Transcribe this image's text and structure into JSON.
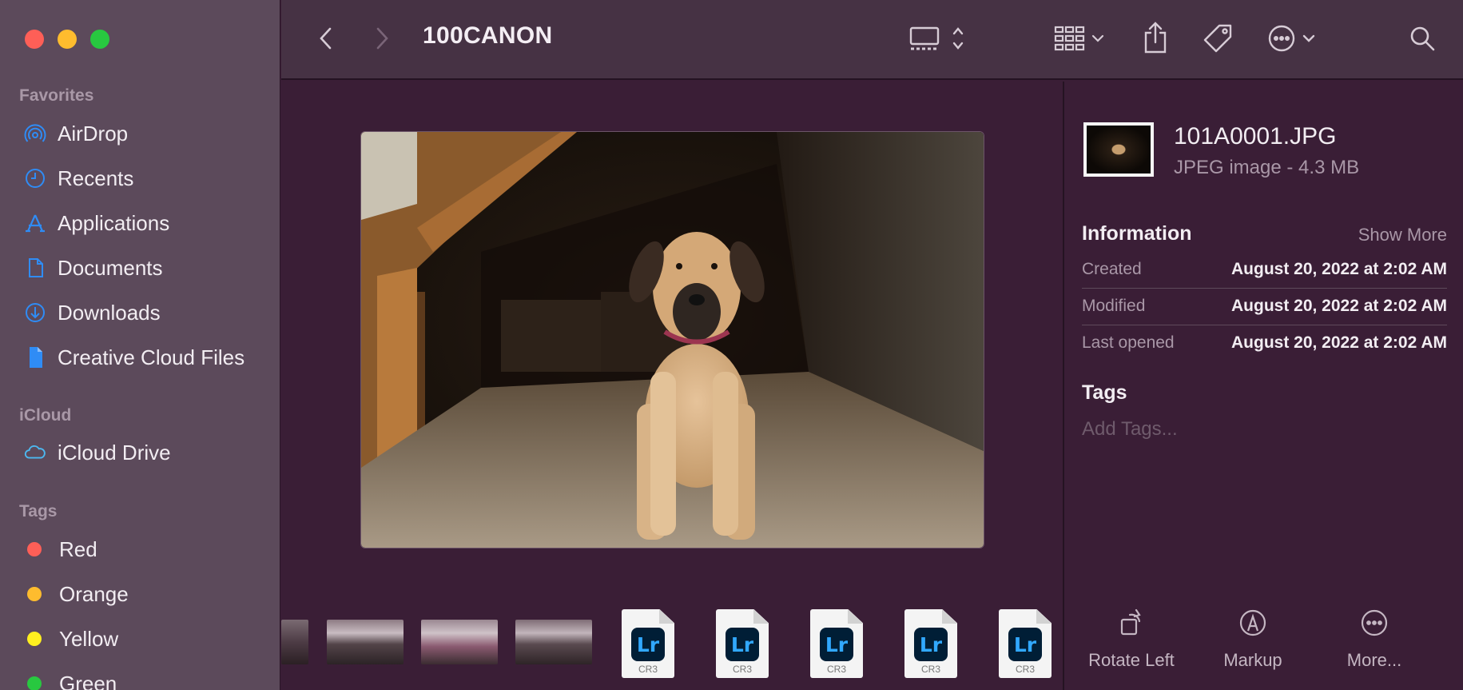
{
  "window": {
    "title": "100CANON"
  },
  "sidebar": {
    "favorites_title": "Favorites",
    "favorites": [
      {
        "label": "AirDrop",
        "icon": "airdrop-icon"
      },
      {
        "label": "Recents",
        "icon": "clock-icon"
      },
      {
        "label": "Applications",
        "icon": "applications-icon"
      },
      {
        "label": "Documents",
        "icon": "document-icon"
      },
      {
        "label": "Downloads",
        "icon": "download-icon"
      },
      {
        "label": "Creative Cloud Files",
        "icon": "file-icon"
      }
    ],
    "icloud_title": "iCloud",
    "icloud": [
      {
        "label": "iCloud Drive",
        "icon": "cloud-icon"
      }
    ],
    "tags_title": "Tags",
    "tags": [
      {
        "label": "Red",
        "color": "#fe5f57"
      },
      {
        "label": "Orange",
        "color": "#febc2e"
      },
      {
        "label": "Yellow",
        "color": "#fff01f"
      },
      {
        "label": "Green",
        "color": "#28c840"
      }
    ]
  },
  "toolbar": {
    "icons": [
      "back-icon",
      "forward-icon",
      "view-gallery-icon",
      "group-icon",
      "share-icon",
      "tag-icon",
      "more-icon",
      "search-icon"
    ]
  },
  "filmstrip": {
    "cr3_label": "Lr",
    "cr3_ext": "CR3"
  },
  "inspector": {
    "file_name": "101A0001.JPG",
    "file_kind": "JPEG image - 4.3 MB",
    "information_title": "Information",
    "show_more": "Show More",
    "rows": [
      {
        "key": "Created",
        "value": "August 20, 2022 at 2:02 AM"
      },
      {
        "key": "Modified",
        "value": "August 20, 2022 at 2:02 AM"
      },
      {
        "key": "Last opened",
        "value": "August 20, 2022 at 2:02 AM"
      }
    ],
    "tags_title": "Tags",
    "add_tags_placeholder": "Add Tags...",
    "actions": [
      {
        "label": "Rotate Left",
        "icon": "rotate-left-icon"
      },
      {
        "label": "Markup",
        "icon": "markup-icon"
      },
      {
        "label": "More...",
        "icon": "more-circle-icon"
      }
    ]
  },
  "colors": {
    "accent": "#2f8cf5",
    "background": "#3a1e36",
    "sidebar": "#5c4a5b"
  }
}
